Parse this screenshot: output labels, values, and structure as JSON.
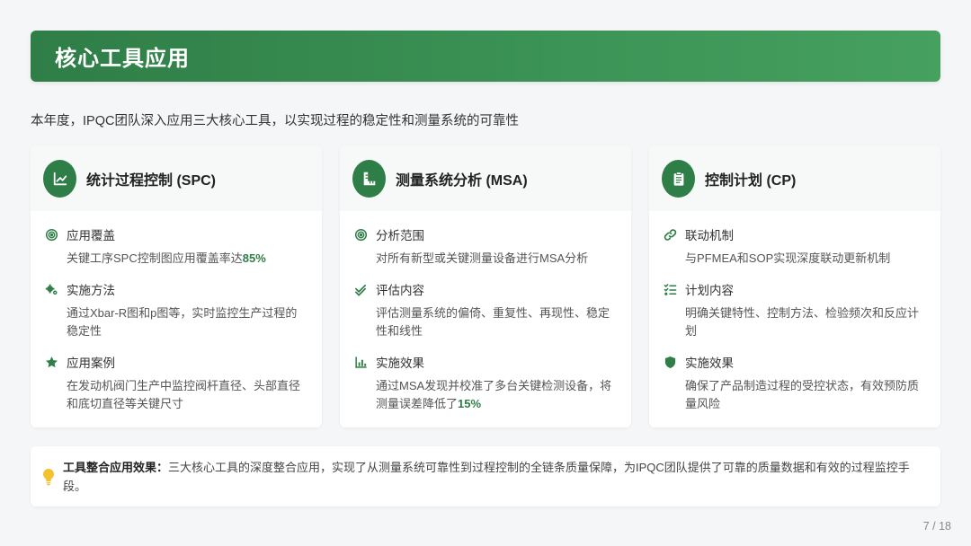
{
  "title": "核心工具应用",
  "subtitle": "本年度，IPQC团队深入应用三大核心工具，以实现过程的稳定性和测量系统的可靠性",
  "colors": {
    "accent": "#2f7d47",
    "highlight": "#2f7d47",
    "bulb": "#f2c230"
  },
  "cards": [
    {
      "title": "统计过程控制 (SPC)",
      "icon": "line-chart-icon",
      "items": [
        {
          "icon": "target-icon",
          "title": "应用覆盖",
          "desc_before": "关键工序SPC控制图应用覆盖率达",
          "highlight": "85%",
          "desc_after": ""
        },
        {
          "icon": "gears-icon",
          "title": "实施方法",
          "desc_before": "通过Xbar-R图和p图等，实时监控生产过程的稳定性",
          "highlight": "",
          "desc_after": ""
        },
        {
          "icon": "star-icon",
          "title": "应用案例",
          "desc_before": "在发动机阀门生产中监控阀杆直径、头部直径和底切直径等关键尺寸",
          "highlight": "",
          "desc_after": ""
        }
      ]
    },
    {
      "title": "测量系统分析 (MSA)",
      "icon": "ruler-icon",
      "items": [
        {
          "icon": "target-icon",
          "title": "分析范围",
          "desc_before": "对所有新型或关键测量设备进行MSA分析",
          "highlight": "",
          "desc_after": ""
        },
        {
          "icon": "double-check-icon",
          "title": "评估内容",
          "desc_before": "评估测量系统的偏倚、重复性、再现性、稳定性和线性",
          "highlight": "",
          "desc_after": ""
        },
        {
          "icon": "bar-chart-icon",
          "title": "实施效果",
          "desc_before": "通过MSA发现并校准了多台关键检测设备，将测量误差降低了",
          "highlight": "15%",
          "desc_after": ""
        }
      ]
    },
    {
      "title": "控制计划 (CP)",
      "icon": "clipboard-icon",
      "items": [
        {
          "icon": "link-icon",
          "title": "联动机制",
          "desc_before": "与PFMEA和SOP实现深度联动更新机制",
          "highlight": "",
          "desc_after": ""
        },
        {
          "icon": "task-list-icon",
          "title": "计划内容",
          "desc_before": "明确关键特性、控制方法、检验频次和反应计划",
          "highlight": "",
          "desc_after": ""
        },
        {
          "icon": "shield-icon",
          "title": "实施效果",
          "desc_before": "确保了产品制造过程的受控状态，有效预防质量风险",
          "highlight": "",
          "desc_after": ""
        }
      ]
    }
  ],
  "summary": {
    "lead": "工具整合应用效果：",
    "text": "三大核心工具的深度整合应用，实现了从测量系统可靠性到过程控制的全链条质量保障，为IPQC团队提供了可靠的质量数据和有效的过程监控手段。"
  },
  "page_number": "7 / 18"
}
